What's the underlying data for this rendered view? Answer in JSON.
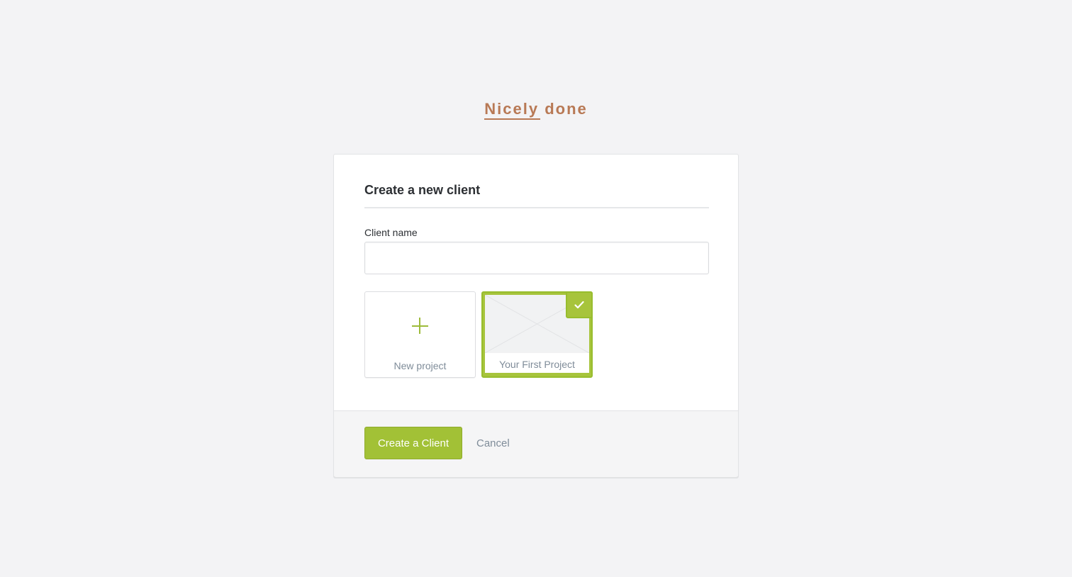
{
  "brand": {
    "first_word": "Nicely",
    "second_word": "done",
    "color": "#b87955"
  },
  "dialog": {
    "title": "Create a new client",
    "client_name_label": "Client name",
    "client_name_value": "",
    "client_name_placeholder": ""
  },
  "projects": [
    {
      "label": "New project",
      "kind": "add",
      "icon": "plus-icon",
      "selected": false
    },
    {
      "label": "Your First Project",
      "kind": "project",
      "icon": "image-placeholder-icon",
      "selected": true
    }
  ],
  "footer": {
    "primary_label": "Create a Client",
    "cancel_label": "Cancel"
  },
  "colors": {
    "accent": "#a2c136",
    "background": "#f3f3f5",
    "muted_text": "#7f8c99"
  }
}
